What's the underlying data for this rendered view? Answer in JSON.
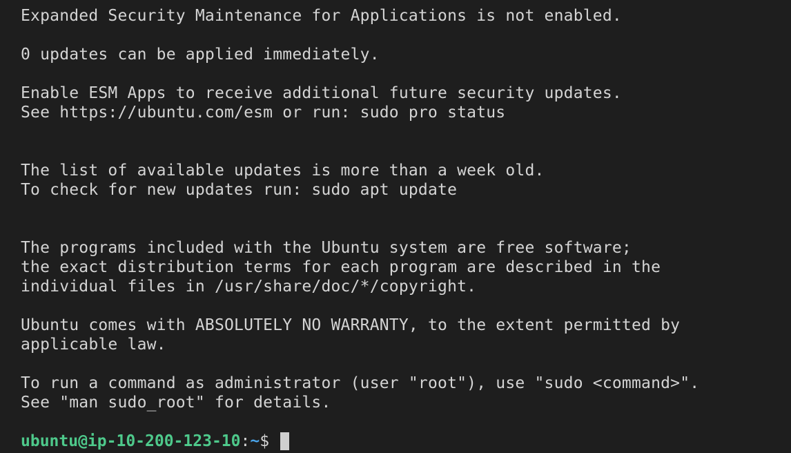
{
  "terminal": {
    "lines": [
      "Expanded Security Maintenance for Applications is not enabled.",
      "",
      "0 updates can be applied immediately.",
      "",
      "Enable ESM Apps to receive additional future security updates.",
      "See https://ubuntu.com/esm or run: sudo pro status",
      "",
      "",
      "The list of available updates is more than a week old.",
      "To check for new updates run: sudo apt update",
      "",
      "",
      "The programs included with the Ubuntu system are free software;",
      "the exact distribution terms for each program are described in the",
      "individual files in /usr/share/doc/*/copyright.",
      "",
      "Ubuntu comes with ABSOLUTELY NO WARRANTY, to the extent permitted by",
      "applicable law.",
      "",
      "To run a command as administrator (user \"root\"), use \"sudo <command>\".",
      "See \"man sudo_root\" for details.",
      ""
    ],
    "prompt": {
      "user_host": "ubuntu@ip-10-200-123-10",
      "separator": ":",
      "path": "~",
      "symbol": "$ "
    }
  },
  "colors": {
    "background": "#1e1e1e",
    "text": "#d4d4d4",
    "prompt_user": "#4ec98b",
    "prompt_path": "#4aa3e8",
    "cursor": "#cfcfcf"
  }
}
